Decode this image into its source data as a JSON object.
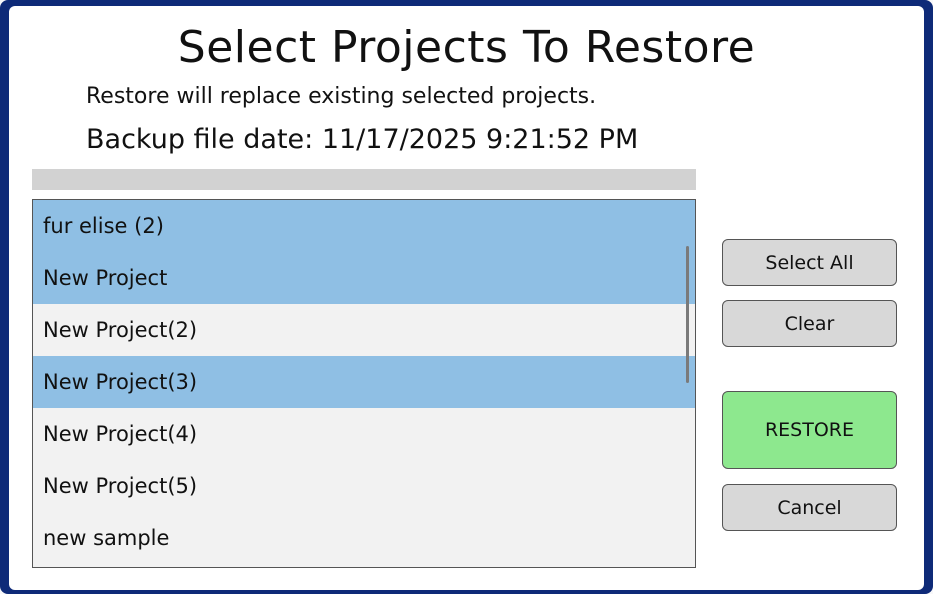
{
  "dialog": {
    "title": "Select Projects To Restore",
    "subtitle": "Restore will replace existing selected projects.",
    "backup_date": "Backup file date: 11/17/2025 9:21:52 PM",
    "progress": 0
  },
  "projects": [
    {
      "label": "fur elise (2)",
      "selected": true
    },
    {
      "label": "New Project",
      "selected": true
    },
    {
      "label": "New Project(2)",
      "selected": false
    },
    {
      "label": "New Project(3)",
      "selected": true
    },
    {
      "label": "New Project(4)",
      "selected": false
    },
    {
      "label": "New Project(5)",
      "selected": false
    },
    {
      "label": "new sample",
      "selected": false
    }
  ],
  "buttons": {
    "select_all": "Select All",
    "clear": "Clear",
    "restore": "RESTORE",
    "cancel": "Cancel"
  },
  "colors": {
    "selected_row": "#8fbfe4",
    "restore_button": "#8de88e",
    "frame": "#0e2a78"
  }
}
